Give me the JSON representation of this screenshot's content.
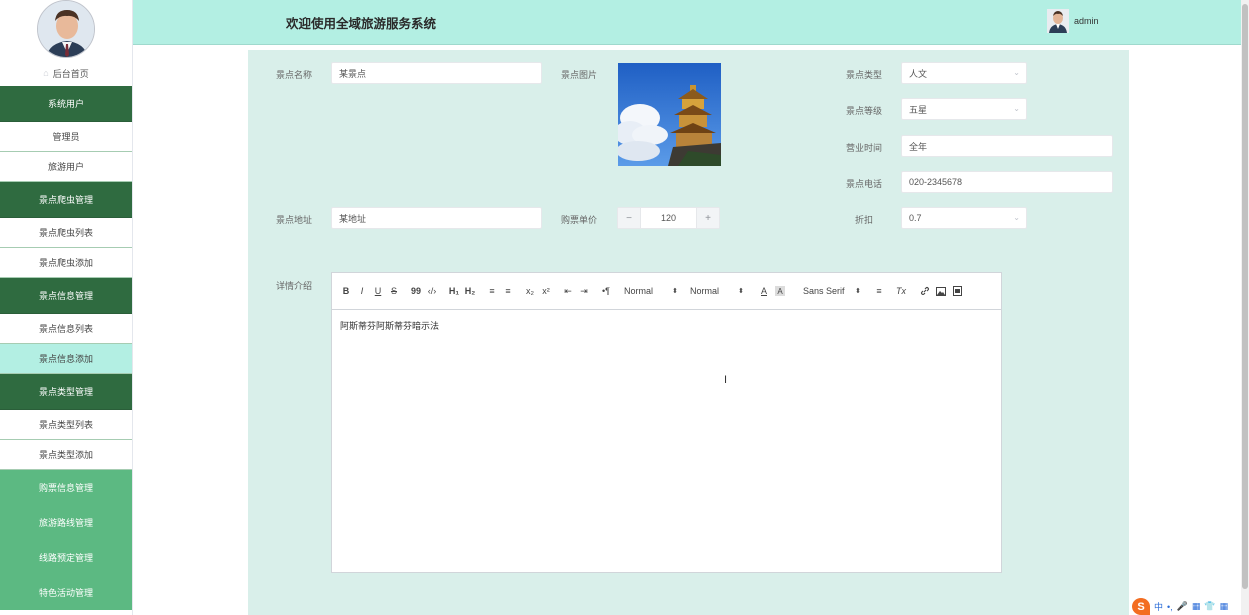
{
  "header": {
    "title": "欢迎使用全域旅游服务系统",
    "username": "admin"
  },
  "sidebar": {
    "home_label": "后台首页",
    "menu": [
      {
        "type": "group",
        "label": "系统用户"
      },
      {
        "type": "item",
        "label": "管理员"
      },
      {
        "type": "item",
        "label": "旅游用户"
      },
      {
        "type": "group",
        "label": "景点爬虫管理"
      },
      {
        "type": "item",
        "label": "景点爬虫列表"
      },
      {
        "type": "item",
        "label": "景点爬虫添加"
      },
      {
        "type": "group",
        "label": "景点信息管理"
      },
      {
        "type": "item",
        "label": "景点信息列表"
      },
      {
        "type": "item",
        "label": "景点信息添加",
        "active": true
      },
      {
        "type": "group",
        "label": "景点类型管理"
      },
      {
        "type": "item",
        "label": "景点类型列表"
      },
      {
        "type": "item",
        "label": "景点类型添加"
      },
      {
        "type": "light",
        "label": "购票信息管理"
      },
      {
        "type": "light",
        "label": "旅游路线管理"
      },
      {
        "type": "light",
        "label": "线路预定管理"
      },
      {
        "type": "light",
        "label": "特色活动管理"
      }
    ]
  },
  "form": {
    "name": {
      "label": "景点名称",
      "value": "某景点"
    },
    "image": {
      "label": "景点图片"
    },
    "type": {
      "label": "景点类型",
      "value": "人文"
    },
    "level": {
      "label": "景点等级",
      "value": "五星"
    },
    "hours": {
      "label": "营业时间",
      "value": "全年"
    },
    "phone": {
      "label": "景点电话",
      "value": "020-2345678"
    },
    "address": {
      "label": "景点地址",
      "value": "某地址"
    },
    "price": {
      "label": "购票单价",
      "value": "120",
      "minus": "−",
      "plus": "+"
    },
    "discount": {
      "label": "折扣",
      "value": "0.7"
    },
    "detail": {
      "label": "详情介绍",
      "content": "阿斯蒂芬阿斯蒂芬暗示法"
    }
  },
  "editor_toolbar": {
    "bold": "B",
    "italic": "I",
    "underline": "U",
    "strike": "S",
    "quote": "99",
    "code": "‹/›",
    "h1": "H₁",
    "h2": "H₂",
    "ol": "≡",
    "ul": "≡",
    "sub": "x₂",
    "sup": "x²",
    "outdent": "⇤",
    "indent": "⇥",
    "direction": "•¶",
    "size": "Normal",
    "header": "Normal",
    "font": "Sans Serif",
    "color": "A",
    "background": "A",
    "align": "≡",
    "clean": "Tx",
    "link": "🔗",
    "image": "▣",
    "video": "▤"
  },
  "ime": {
    "logo": "S",
    "lang": "中",
    "punct": "•,",
    "mic": "🎤",
    "kbd": "▦",
    "skin": "👕",
    "grid": "▦"
  },
  "colors": {
    "sidebar_dark": "#2f6b40",
    "sidebar_light": "#5cb982",
    "header": "#b3efe3",
    "panel": "#d9efea",
    "active": "#b3efe3"
  }
}
